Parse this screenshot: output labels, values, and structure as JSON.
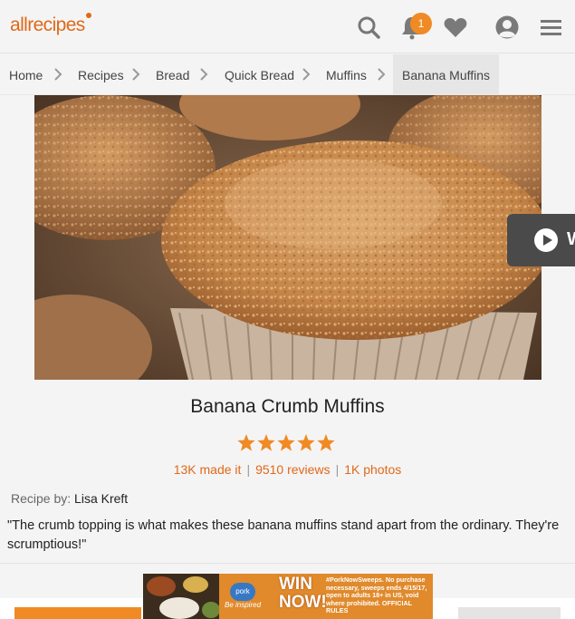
{
  "header": {
    "logo_text": "allrecipes",
    "notifications_count": "1",
    "icons": [
      "search-icon",
      "bell-icon",
      "heart-icon",
      "user-icon",
      "menu-icon"
    ],
    "accent_color": "#f08a24"
  },
  "breadcrumbs": [
    "Home",
    "Recipes",
    "Bread",
    "Quick Bread",
    "Muffins",
    "Banana Muffins"
  ],
  "video_button": {
    "label": "W"
  },
  "recipe": {
    "title": "Banana Crumb Muffins",
    "rating_stars": 5,
    "made_it": "13K made it",
    "reviews": "9510 reviews",
    "photos": "1K photos",
    "byline_label": "Recipe by:",
    "author": "Lisa Kreft",
    "description": "\"The crumb topping is what makes these banana muffins stand apart from the ordinary. They're scrumptious!\""
  },
  "ad": {
    "brand": "pork",
    "tagline": "Be inspired",
    "headline": "WIN NOW!",
    "fine_print": "#PorkNowSweeps. No purchase necessary, sweeps ends 4/15/17, open to adults 18+ in US, void where prohibited. OFFICIAL RULES"
  }
}
